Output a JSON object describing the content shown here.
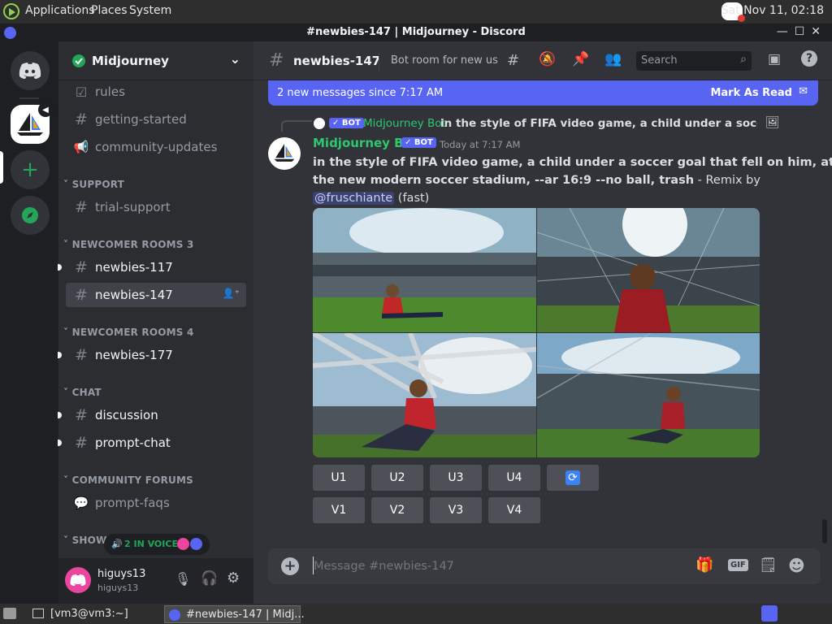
{
  "os_panel": {
    "menus": [
      "Applications",
      "Places",
      "System"
    ],
    "clock": "Sat Nov 11, 02:18"
  },
  "window": {
    "title": "#newbies-147 | Midjourney - Discord"
  },
  "server": {
    "name": "Midjourney"
  },
  "channels": {
    "rules": "rules",
    "getting_started": "getting-started",
    "community_updates": "community-updates",
    "cat_support": "SUPPORT",
    "trial_support": "trial-support",
    "cat_newcomer3": "NEWCOMER ROOMS 3",
    "newbies117": "newbies-117",
    "newbies147": "newbies-147",
    "cat_newcomer4": "NEWCOMER ROOMS 4",
    "newbies177": "newbies-177",
    "cat_chat": "CHAT",
    "discussion": "discussion",
    "prompt_chat": "prompt-chat",
    "cat_forums": "COMMUNITY FORUMS",
    "prompt_faqs": "prompt-faqs",
    "cat_showcase": "SHOWC"
  },
  "voice": {
    "label": "2 IN VOICE"
  },
  "user": {
    "name": "higuys13",
    "tag": "higuys13"
  },
  "header": {
    "channel": "newbies-147",
    "topic": "Bot room for new us...",
    "search_placeholder": "Search"
  },
  "banner": {
    "text": "2 new messages since 7:17 AM",
    "action": "Mark As Read"
  },
  "reply": {
    "badge": "BOT",
    "author": "Midjourney Bot",
    "text": "in the style of FIFA video game, a child under a soccer goal that"
  },
  "message": {
    "author": "Midjourney Bot",
    "badge": "BOT",
    "time": "Today at 7:17 AM",
    "prompt_line1": "in the style of FIFA video game, a child under a soccer goal that fell on him, at",
    "prompt_line2": "the new modern soccer stadium, --ar 16:9 --no ball, trash",
    "suffix": " - Remix by",
    "mention": "@fruschiante",
    "speed": " (fast)"
  },
  "buttons": {
    "u": [
      "U1",
      "U2",
      "U3",
      "U4"
    ],
    "v": [
      "V1",
      "V2",
      "V3",
      "V4"
    ]
  },
  "composer": {
    "placeholder": "Message #newbies-147"
  },
  "taskbar": {
    "terminal": "[vm3@vm3:~]",
    "discord": "#newbies-147 | Midj..."
  },
  "colors": {
    "blurple": "#5865f2",
    "green": "#23a55a",
    "bot_name": "#2dc770"
  }
}
